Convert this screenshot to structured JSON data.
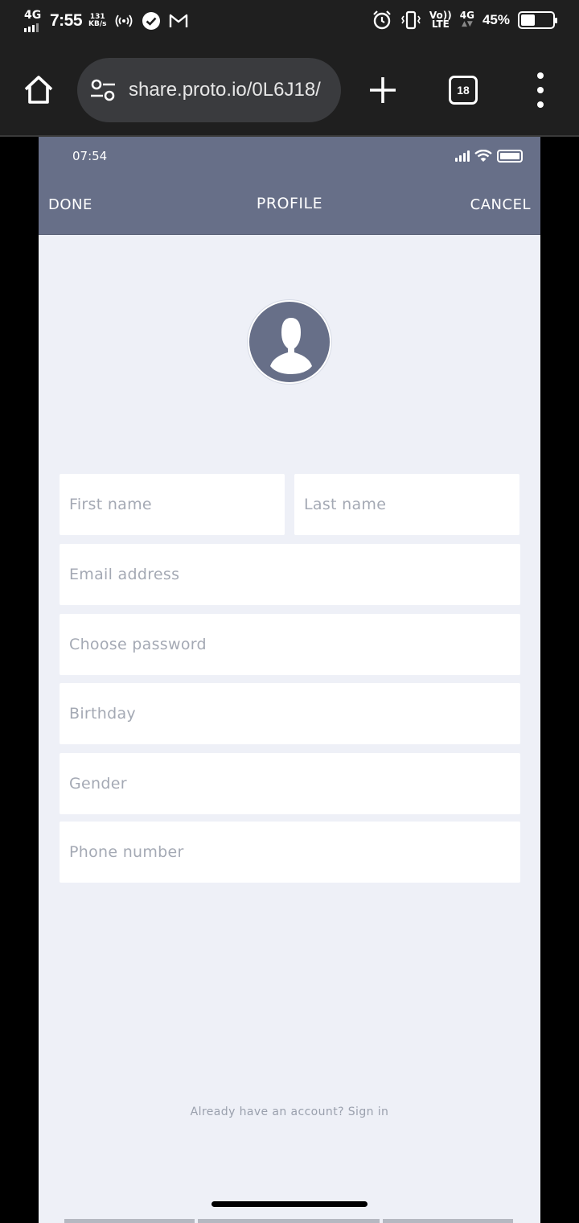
{
  "system_status": {
    "network_left": "4G",
    "time": "7:55",
    "speed_value": "131",
    "speed_unit": "KB/s",
    "volte_line1": "Vo))",
    "volte_line2": "LTE",
    "network_right": "4G",
    "battery_percent": "45%",
    "battery_level": 0.45
  },
  "browser": {
    "url": "share.proto.io/0L6J18/",
    "tab_count": "18"
  },
  "prototype": {
    "status_time": "07:54",
    "nav": {
      "done_label": "DONE",
      "title": "PROFILE",
      "cancel_label": "CANCEL"
    },
    "form": {
      "first_name_placeholder": "First name",
      "last_name_placeholder": "Last name",
      "email_placeholder": "Email address",
      "password_placeholder": "Choose password",
      "birthday_placeholder": "Birthday",
      "gender_placeholder": "Gender",
      "phone_placeholder": "Phone number"
    },
    "signin_text": "Already have an account? Sign in"
  },
  "colors": {
    "nav_background": "#676f88",
    "page_background": "#eef0f7",
    "placeholder_text": "#a4a9b4"
  }
}
